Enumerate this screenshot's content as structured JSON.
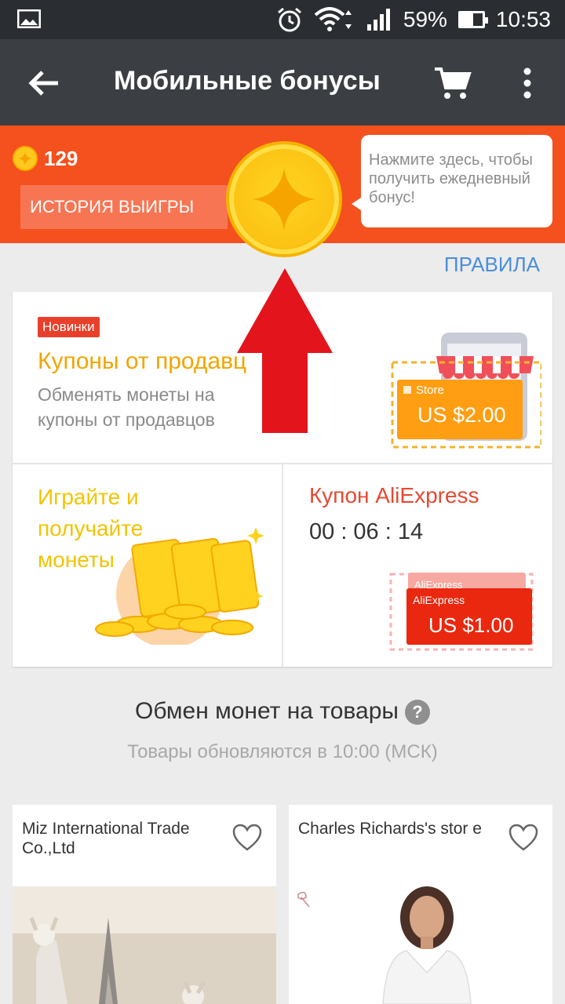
{
  "status_bar": {
    "battery_percent": "59%",
    "battery_level": 0.59,
    "time": "10:53"
  },
  "app_bar": {
    "title": "Мобильные бонусы"
  },
  "header": {
    "coin_count": "129",
    "history_button": "ИСТОРИЯ ВЫИГРЫ",
    "tooltip": "Нажмите здесь, чтобы получить ежедневный бонус!"
  },
  "rules_link": "ПРАВИЛА",
  "seller_coupons": {
    "badge": "Новинки",
    "title": "Купоны от продавц",
    "description": "Обменять монеты на купоны от продавцов",
    "card_label": "Store",
    "card_value": "US $2.00"
  },
  "play": {
    "title": "Играйте и получайте монеты"
  },
  "ali_coupon": {
    "title": "Купон AliExpress",
    "timer": "00 : 06 : 14",
    "card_label_back": "AliExpress",
    "card_label": "AliExpress",
    "card_value": "US $1.00"
  },
  "exchange": {
    "title": "Обмен монет на товары",
    "help_icon": "?",
    "subtitle": "Товары обновляются в 10:00 (МСК)"
  },
  "products": [
    {
      "store": "Miz International Trade Co.,Ltd"
    },
    {
      "store": "Charles Richards's stor e"
    }
  ],
  "colors": {
    "status_bar": "#2a2d31",
    "app_bar": "#3b3f43",
    "header": "#f4511e",
    "link": "#4a8fd8",
    "arrow": "#e3141c"
  }
}
